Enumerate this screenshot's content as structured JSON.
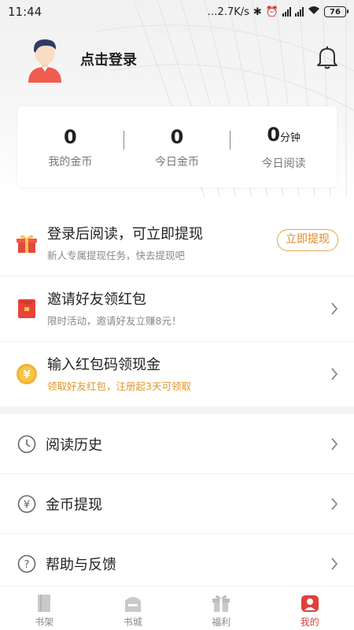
{
  "status_bar": {
    "time": "11:44",
    "network_speed": "…2.7K/s",
    "battery": "76"
  },
  "profile": {
    "login_label": "点击登录"
  },
  "stats": [
    {
      "value": "0",
      "unit": "",
      "label": "我的金币"
    },
    {
      "value": "0",
      "unit": "",
      "label": "今日金币"
    },
    {
      "value": "0",
      "unit": "分钟",
      "label": "今日阅读"
    }
  ],
  "tasks": [
    {
      "title": "登录后阅读，可立即提现",
      "subtitle": "新人专属提现任务，快去提现吧",
      "icon": "gift-icon",
      "action": "立即提现"
    },
    {
      "title": "邀请好友领红包",
      "subtitle": "限时活动，邀请好友立赚8元！",
      "icon": "red-envelope-icon"
    },
    {
      "title": "输入红包码领现金",
      "subtitle": "领取好友红包，注册起3天可领取",
      "icon": "yuan-coin-icon"
    }
  ],
  "menu": [
    {
      "label": "阅读历史",
      "icon": "clock-icon"
    },
    {
      "label": "金币提现",
      "icon": "yuan-icon"
    },
    {
      "label": "帮助与反馈",
      "icon": "question-icon"
    }
  ],
  "tabbar": [
    {
      "label": "书架",
      "icon": "bookshelf-icon",
      "active": false
    },
    {
      "label": "书城",
      "icon": "bookstore-icon",
      "active": false
    },
    {
      "label": "福利",
      "icon": "gift-icon",
      "active": false
    },
    {
      "label": "我的",
      "icon": "profile-icon",
      "active": true
    }
  ],
  "colors": {
    "accent_orange": "#e18a2a",
    "accent_red": "#e0413a",
    "coin_yellow": "#f3b233"
  }
}
